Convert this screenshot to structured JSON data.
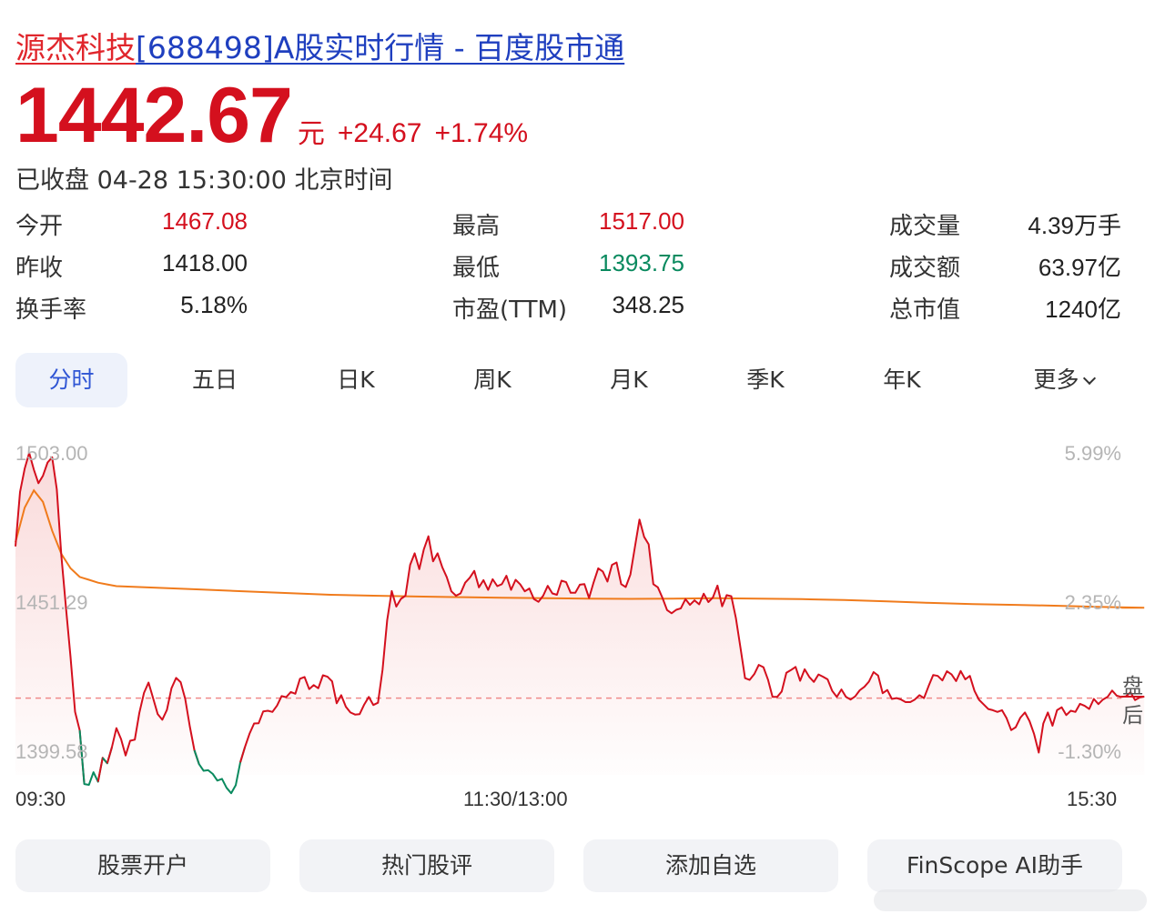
{
  "title": {
    "name": "源杰科技",
    "rest": "[688498]A股实时行情 - 百度股市通"
  },
  "quote": {
    "price": "1442.67",
    "unit": "元",
    "change": "+24.67",
    "change_pct": "+1.74%",
    "status": "已收盘 04-28 15:30:00 北京时间"
  },
  "stats": [
    {
      "label": "今开",
      "value": "1467.08",
      "tone": "red"
    },
    {
      "label": "最高",
      "value": "1517.00",
      "tone": "red"
    },
    {
      "label": "成交量",
      "value": "4.39万手",
      "tone": "plain"
    },
    {
      "label": "昨收",
      "value": "1418.00",
      "tone": "plain"
    },
    {
      "label": "最低",
      "value": "1393.75",
      "tone": "green"
    },
    {
      "label": "成交额",
      "value": "63.97亿",
      "tone": "plain"
    },
    {
      "label": "换手率",
      "value": "5.18%",
      "tone": "plain"
    },
    {
      "label": "市盈(TTM)",
      "value": "348.25",
      "tone": "plain"
    },
    {
      "label": "总市值",
      "value": "1240亿",
      "tone": "plain"
    }
  ],
  "tabs": [
    "分时",
    "五日",
    "日K",
    "周K",
    "月K",
    "季K",
    "年K",
    "更多"
  ],
  "active_tab": "分时",
  "chart": {
    "y_left": [
      "1503.00",
      "1451.29",
      "1399.58"
    ],
    "y_right": [
      "5.99%",
      "2.35%",
      "-1.30%"
    ],
    "x_labels": [
      "09:30",
      "11:30/13:00",
      "15:30"
    ],
    "after_hours_label": [
      "盘",
      "后"
    ],
    "colors": {
      "up": "#d4101e",
      "down": "#0a8a5f",
      "avg": "#f07b1c",
      "prev_close": "#f08a8a",
      "after_hours_bg": "#e9ecfb"
    }
  },
  "chart_data": {
    "type": "line",
    "y_range": [
      1399.58,
      1503.0
    ],
    "prev_close": 1418.0,
    "series": [
      {
        "name": "",
        "x_count": 242,
        "values": [
          1470.6,
          1489.4,
          1497.5,
          1503.0,
          1497.2,
          1492.5,
          1495.1,
          1499.7,
          1501.5,
          1490.4,
          1467.4,
          1449.3,
          1432.2,
          1413.2,
          1406.8,
          1388.2,
          1387.9,
          1392.3,
          1389.0,
          1397.3,
          1395.4,
          1400.9,
          1407.6,
          1403.8,
          1398.1,
          1403.2,
          1403.6,
          1412.9,
          1419.8,
          1423.4,
          1418.0,
          1412.4,
          1410.5,
          1413.9,
          1421.4,
          1425.0,
          1423.5,
          1417.7,
          1408.1,
          1399.9,
          1395.1,
          1392.8,
          1393.0,
          1391.7,
          1389.4,
          1390.0,
          1386.9,
          1385.0,
          1387.8,
          1395.7,
          1401.0,
          1405.6,
          1409.2,
          1409.3,
          1413.4,
          1413.6,
          1413.2,
          1415.4,
          1418.7,
          1418.3,
          1420.1,
          1419.5,
          1424.7,
          1425.3,
          1421.1,
          1422.5,
          1421.4,
          1425.9,
          1425.4,
          1423.8,
          1416.2,
          1419.0,
          1415.0,
          1413.0,
          1412.3,
          1412.4,
          1415.8,
          1418.4,
          1415.6,
          1416.4,
          1427.8,
          1445.0,
          1455.1,
          1449.7,
          1452.4,
          1453.5,
          1464.2,
          1468.2,
          1462.7,
          1469.6,
          1474.1,
          1465.4,
          1468.2,
          1463.4,
          1459.9,
          1455.0,
          1453.5,
          1454.3,
          1458.0,
          1459.7,
          1462.1,
          1456.4,
          1458.9,
          1455.5,
          1459.2,
          1456.8,
          1457.5,
          1460.4,
          1455.5,
          1459.0,
          1457.4,
          1455.0,
          1456.0,
          1452.3,
          1451.4,
          1453.5,
          1456.9,
          1454.3,
          1453.8,
          1458.7,
          1458.2,
          1454.5,
          1454.5,
          1457.3,
          1457.5,
          1452.7,
          1458.1,
          1463.0,
          1461.9,
          1458.4,
          1464.2,
          1465.0,
          1457.5,
          1456.5,
          1460.8,
          1470.4,
          1479.9,
          1473.9,
          1471.3,
          1457.5,
          1456.4,
          1452.7,
          1448.5,
          1447.4,
          1448.6,
          1449.1,
          1452.3,
          1450.3,
          1451.9,
          1450.5,
          1454.2,
          1451.3,
          1452.9,
          1457.0,
          1449.8,
          1453.7,
          1453.3,
          1445.8,
          1435.4,
          1424.9,
          1424.3,
          1426.3,
          1429.5,
          1428.7,
          1424.4,
          1418.4,
          1418.4,
          1420.3,
          1426.8,
          1427.7,
          1428.8,
          1424.0,
          1428.0,
          1425.3,
          1423.6,
          1426.2,
          1425.4,
          1424.5,
          1420.5,
          1418.4,
          1421.0,
          1418.4,
          1417.5,
          1418.6,
          1420.7,
          1421.9,
          1423.7,
          1427.0,
          1425.8,
          1419.7,
          1420.8,
          1417.7,
          1418.0,
          1417.5,
          1416.6,
          1416.6,
          1417.5,
          1419.0,
          1418.0,
          1422.2,
          1426.0,
          1425.7,
          1424.1,
          1427.3,
          1426.2,
          1423.9,
          1427.4,
          1424.5,
          1425.7,
          1420.5,
          1417.4,
          1415.8,
          1414.2,
          1413.8,
          1413.2,
          1413.8,
          1411.0,
          1406.9,
          1407.9,
          1411.2,
          1413.0,
          1410.0,
          1405.5,
          1399.1,
          1409.2,
          1413.0,
          1408.4,
          1413.8,
          1414.8,
          1412.1,
          1413.6,
          1413.2,
          1416.0,
          1415.3,
          1414.2,
          1417.7,
          1415.9,
          1417.5,
          1418.4,
          1420.6,
          1418.8,
          1418.4,
          1418.6,
          1420.0,
          1417.3,
          1418.2,
          1418.5
        ]
      },
      {
        "name": "",
        "values": [
          1472.0,
          1484.0,
          1490.0,
          1486.0,
          1476.0,
          1468.0,
          1463.0,
          1460.0,
          1459.0,
          1458.0,
          1457.4,
          1456.8,
          1456.2,
          1455.6,
          1455.0,
          1454.4,
          1453.8,
          1453.5,
          1453.2,
          1453.0,
          1452.8,
          1452.6,
          1452.5,
          1452.4,
          1452.5,
          1452.6,
          1452.5,
          1452.3,
          1452.0,
          1451.5,
          1451.0,
          1450.6,
          1450.3,
          1450.0,
          1449.6,
          1449.3
        ]
      }
    ]
  },
  "buttons": [
    "股票开户",
    "热门股评",
    "添加自选",
    "FinScope AI助手"
  ]
}
